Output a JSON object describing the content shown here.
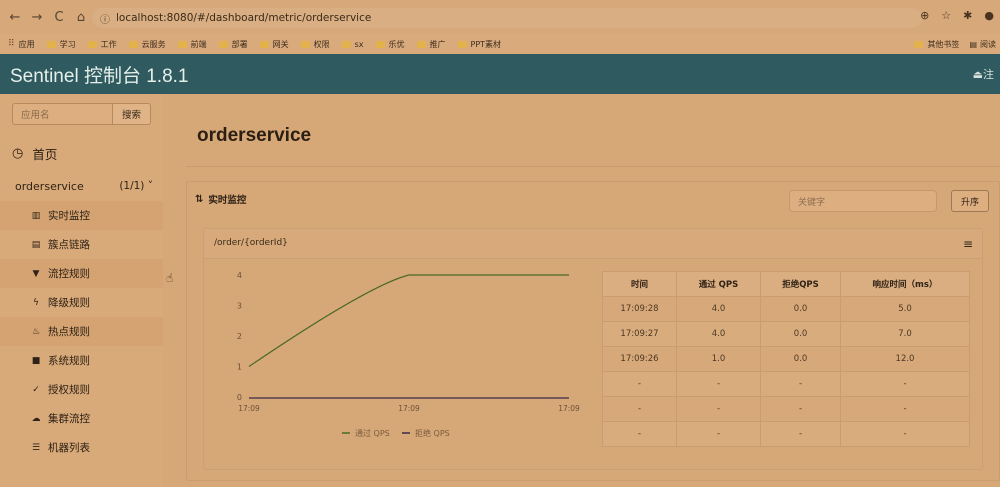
{
  "browser": {
    "url": "localhost:8080/#/dashboard/metric/orderservice",
    "bookmarks": [
      "应用",
      "学习",
      "工作",
      "云服务",
      "前端",
      "部署",
      "网关",
      "权限",
      "sx",
      "乐优",
      "推广",
      "PPT素材"
    ],
    "other_bookmarks": "其他书签",
    "reading_list": "阅读"
  },
  "app": {
    "title": "Sentinel 控制台 1.8.1",
    "logout": "注"
  },
  "sidebar": {
    "search_placeholder": "应用名",
    "search_button": "搜索",
    "home": "首页",
    "app_name": "orderservice",
    "app_count": "(1/1)",
    "items": [
      {
        "label": "实时监控",
        "icon": "bar-chart-icon"
      },
      {
        "label": "簇点链路",
        "icon": "list-icon"
      },
      {
        "label": "流控规则",
        "icon": "filter-icon"
      },
      {
        "label": "降级规则",
        "icon": "bolt-icon"
      },
      {
        "label": "热点规则",
        "icon": "fire-icon"
      },
      {
        "label": "系统规则",
        "icon": "lock-icon"
      },
      {
        "label": "授权规则",
        "icon": "check-circle-icon"
      },
      {
        "label": "集群流控",
        "icon": "cloud-icon"
      },
      {
        "label": "机器列表",
        "icon": "table-list-icon"
      }
    ]
  },
  "main": {
    "title": "orderservice",
    "panel_title": "实时监控",
    "keyword_placeholder": "关键字",
    "sort_button": "升序",
    "resource": "/order/{orderId}"
  },
  "chart_data": {
    "type": "line",
    "x_ticks": [
      "17:09",
      "17:09",
      "17:09"
    ],
    "y_ticks": [
      "0",
      "1",
      "2",
      "3",
      "4"
    ],
    "ylim": [
      0,
      4
    ],
    "series": [
      {
        "name": "通过 QPS",
        "color": "#4a6a24",
        "x": [
          0,
          0.5,
          1.0
        ],
        "values": [
          1,
          4,
          4
        ]
      },
      {
        "name": "拒绝 QPS",
        "color": "#3a2a4a",
        "x": [
          0,
          0.5,
          1.0
        ],
        "values": [
          0,
          0,
          0
        ]
      }
    ],
    "legend": "bottom"
  },
  "table": {
    "headers": [
      "时间",
      "通过 QPS",
      "拒绝QPS",
      "响应时间（ms）"
    ],
    "rows": [
      [
        "17:09:28",
        "4.0",
        "0.0",
        "5.0"
      ],
      [
        "17:09:27",
        "4.0",
        "0.0",
        "7.0"
      ],
      [
        "17:09:26",
        "1.0",
        "0.0",
        "12.0"
      ],
      [
        "-",
        "-",
        "-",
        "-"
      ],
      [
        "-",
        "-",
        "-",
        "-"
      ],
      [
        "-",
        "-",
        "-",
        "-"
      ]
    ]
  }
}
